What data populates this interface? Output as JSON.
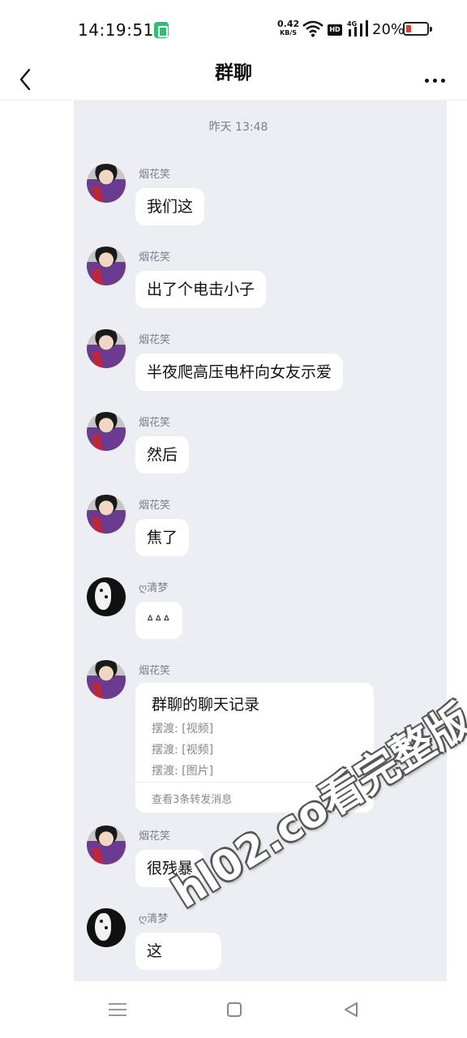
{
  "status_bar": {
    "time": "14:19:51",
    "net_speed_value": "0.42",
    "net_speed_unit": "KB/S",
    "hd_label": "HD",
    "network_label": "4G",
    "battery": "20%"
  },
  "header": {
    "title": "群聊",
    "back_icon": "chevron-left-icon",
    "more_icon": "more-dots-icon"
  },
  "chat": {
    "timestamp": "昨天 13:48",
    "messages": [
      {
        "sender": "烟花笑",
        "text": "我们这"
      },
      {
        "sender": "烟花笑",
        "text": "出了个电击小子"
      },
      {
        "sender": "烟花笑",
        "text": "半夜爬高压电杆向女友示爱"
      },
      {
        "sender": "烟花笑",
        "text": "然后"
      },
      {
        "sender": "烟花笑",
        "text": "焦了"
      },
      {
        "sender": "ღ清梦",
        "text": "ᐞᐞᐞ"
      },
      {
        "sender": "烟花笑",
        "forward": {
          "title": "群聊的聊天记录",
          "lines": [
            "摆渡: [视频]",
            "摆渡: [视频]",
            "摆渡: [图片]"
          ],
          "footer": "查看3条转发消息"
        }
      },
      {
        "sender": "烟花笑",
        "text": "很残暴"
      },
      {
        "sender": "ღ清梦",
        "text": "这"
      }
    ]
  },
  "watermark": "hl02.co看完整版",
  "nav_bar": {
    "menu_icon": "menu-lines-icon",
    "home_icon": "square-home-icon",
    "back_icon": "triangle-back-icon"
  },
  "colors": {
    "chat_background": "#edeef3",
    "bubble": "#ffffff",
    "meta_text": "#7b7f87"
  }
}
